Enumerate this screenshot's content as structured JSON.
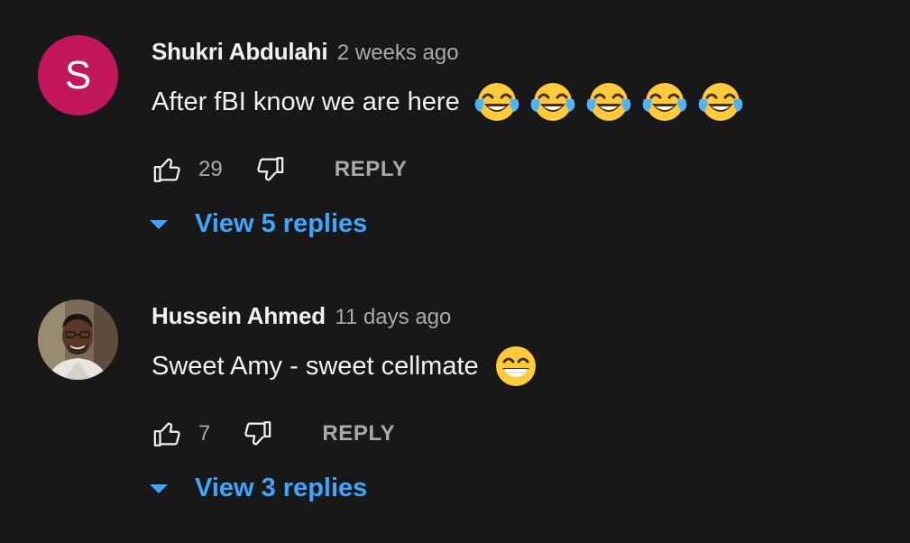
{
  "comments": [
    {
      "author": "Shukri Abdulahi",
      "time": "2 weeks ago",
      "avatar_letter": "S",
      "text": "After fBI know we are here",
      "emojis": [
        "face-with-tears-of-joy",
        "face-with-tears-of-joy",
        "face-with-tears-of-joy",
        "face-with-tears-of-joy",
        "face-with-tears-of-joy"
      ],
      "likes": "29",
      "reply_label": "REPLY",
      "view_replies": "View 5 replies"
    },
    {
      "author": "Hussein Ahmed",
      "time": "11 days ago",
      "text": "Sweet Amy - sweet cellmate",
      "emojis": [
        "beaming-face-with-smiling-eyes"
      ],
      "likes": "7",
      "reply_label": "REPLY",
      "view_replies": "View 3 replies"
    }
  ],
  "colors": {
    "background": "#181818",
    "primary_text": "#f1f1f1",
    "secondary_text": "#aaaaaa",
    "link_blue": "#3ea6ff",
    "avatar_pink": "#c2185b"
  }
}
